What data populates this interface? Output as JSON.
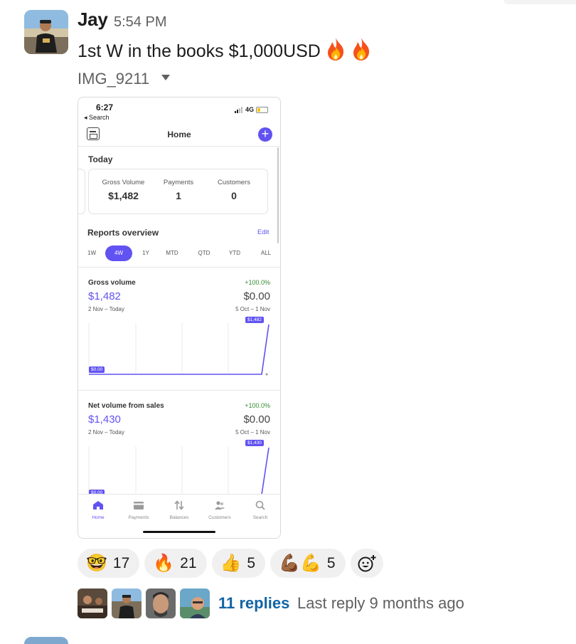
{
  "message": {
    "author": "Jay",
    "time": "5:54 PM",
    "text": "1st W in the books $1,000USD",
    "emoji_icons": [
      "fire-icon",
      "fire-icon"
    ],
    "attachment_name": "IMG_9211"
  },
  "screenshot": {
    "status_time": "6:27",
    "back_label": "◂ Search",
    "network": "4G",
    "header_title": "Home",
    "today_heading": "Today",
    "stats": [
      {
        "label": "Gross Volume",
        "value": "$1,482"
      },
      {
        "label": "Payments",
        "value": "1"
      },
      {
        "label": "Customers",
        "value": "0"
      }
    ],
    "reports_title": "Reports overview",
    "edit_label": "Edit",
    "ranges": [
      "1W",
      "4W",
      "1Y",
      "MTD",
      "QTD",
      "YTD",
      "ALL"
    ],
    "active_range": "4W",
    "gross": {
      "label": "Gross volume",
      "change": "+100.0%",
      "current": "$1,482",
      "previous": "$0.00",
      "current_period": "2 Nov – Today",
      "previous_period": "5 Oct – 1 Nov",
      "max_tag": "$1,482",
      "min_tag": "$0.00"
    },
    "net": {
      "label": "Net volume from sales",
      "change": "+100.0%",
      "current": "$1,430",
      "previous": "$0.00",
      "current_period": "2 Nov – Today",
      "previous_period": "5 Oct – 1 Nov",
      "max_tag": "$1,430",
      "min_tag": "$0.00"
    },
    "tabbar": [
      {
        "label": "Home",
        "icon": "home-icon",
        "active": true
      },
      {
        "label": "Payments",
        "icon": "payments-icon"
      },
      {
        "label": "Balances",
        "icon": "balances-icon"
      },
      {
        "label": "Customers",
        "icon": "customers-icon"
      },
      {
        "label": "Search",
        "icon": "search-icon"
      }
    ],
    "accent": "#6152f2"
  },
  "reactions": [
    {
      "emoji": "🤓",
      "count": "17"
    },
    {
      "emoji": "🔥",
      "count": "21"
    },
    {
      "emoji": "👍",
      "count": "5"
    },
    {
      "emoji": "💪🏾💪",
      "count": "5"
    }
  ],
  "add_reaction_icon": "add-reaction-icon",
  "thread": {
    "replies": "11 replies",
    "last_reply": "Last reply 9 months ago"
  },
  "colors": {
    "link": "#1264a3",
    "muted": "#616061"
  }
}
